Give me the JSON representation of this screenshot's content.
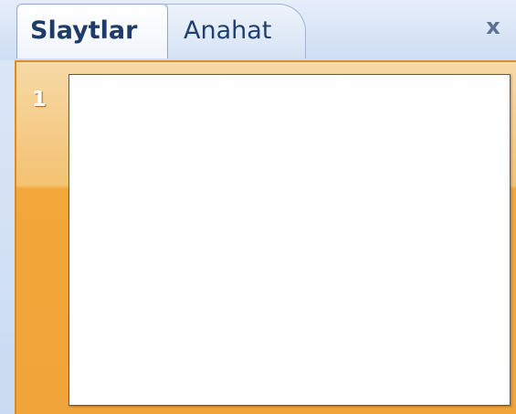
{
  "tabs": [
    {
      "label": "Slaytlar",
      "active": true
    },
    {
      "label": "Anahat",
      "active": false
    }
  ],
  "close_glyph": "x",
  "slides": [
    {
      "number": "1"
    }
  ],
  "colors": {
    "accent_orange": "#f2a73a",
    "tab_text": "#1f3b6a",
    "panel_bg": "#dfe9f7"
  }
}
